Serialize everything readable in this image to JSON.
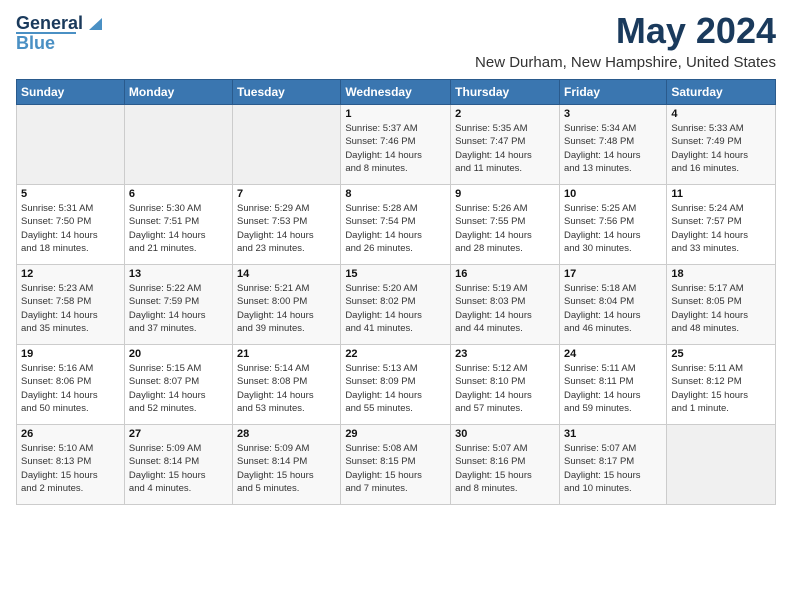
{
  "logo": {
    "line1": "General",
    "line2": "Blue"
  },
  "title": "May 2024",
  "subtitle": "New Durham, New Hampshire, United States",
  "days_of_week": [
    "Sunday",
    "Monday",
    "Tuesday",
    "Wednesday",
    "Thursday",
    "Friday",
    "Saturday"
  ],
  "weeks": [
    [
      {
        "day": "",
        "detail": ""
      },
      {
        "day": "",
        "detail": ""
      },
      {
        "day": "",
        "detail": ""
      },
      {
        "day": "1",
        "detail": "Sunrise: 5:37 AM\nSunset: 7:46 PM\nDaylight: 14 hours\nand 8 minutes."
      },
      {
        "day": "2",
        "detail": "Sunrise: 5:35 AM\nSunset: 7:47 PM\nDaylight: 14 hours\nand 11 minutes."
      },
      {
        "day": "3",
        "detail": "Sunrise: 5:34 AM\nSunset: 7:48 PM\nDaylight: 14 hours\nand 13 minutes."
      },
      {
        "day": "4",
        "detail": "Sunrise: 5:33 AM\nSunset: 7:49 PM\nDaylight: 14 hours\nand 16 minutes."
      }
    ],
    [
      {
        "day": "5",
        "detail": "Sunrise: 5:31 AM\nSunset: 7:50 PM\nDaylight: 14 hours\nand 18 minutes."
      },
      {
        "day": "6",
        "detail": "Sunrise: 5:30 AM\nSunset: 7:51 PM\nDaylight: 14 hours\nand 21 minutes."
      },
      {
        "day": "7",
        "detail": "Sunrise: 5:29 AM\nSunset: 7:53 PM\nDaylight: 14 hours\nand 23 minutes."
      },
      {
        "day": "8",
        "detail": "Sunrise: 5:28 AM\nSunset: 7:54 PM\nDaylight: 14 hours\nand 26 minutes."
      },
      {
        "day": "9",
        "detail": "Sunrise: 5:26 AM\nSunset: 7:55 PM\nDaylight: 14 hours\nand 28 minutes."
      },
      {
        "day": "10",
        "detail": "Sunrise: 5:25 AM\nSunset: 7:56 PM\nDaylight: 14 hours\nand 30 minutes."
      },
      {
        "day": "11",
        "detail": "Sunrise: 5:24 AM\nSunset: 7:57 PM\nDaylight: 14 hours\nand 33 minutes."
      }
    ],
    [
      {
        "day": "12",
        "detail": "Sunrise: 5:23 AM\nSunset: 7:58 PM\nDaylight: 14 hours\nand 35 minutes."
      },
      {
        "day": "13",
        "detail": "Sunrise: 5:22 AM\nSunset: 7:59 PM\nDaylight: 14 hours\nand 37 minutes."
      },
      {
        "day": "14",
        "detail": "Sunrise: 5:21 AM\nSunset: 8:00 PM\nDaylight: 14 hours\nand 39 minutes."
      },
      {
        "day": "15",
        "detail": "Sunrise: 5:20 AM\nSunset: 8:02 PM\nDaylight: 14 hours\nand 41 minutes."
      },
      {
        "day": "16",
        "detail": "Sunrise: 5:19 AM\nSunset: 8:03 PM\nDaylight: 14 hours\nand 44 minutes."
      },
      {
        "day": "17",
        "detail": "Sunrise: 5:18 AM\nSunset: 8:04 PM\nDaylight: 14 hours\nand 46 minutes."
      },
      {
        "day": "18",
        "detail": "Sunrise: 5:17 AM\nSunset: 8:05 PM\nDaylight: 14 hours\nand 48 minutes."
      }
    ],
    [
      {
        "day": "19",
        "detail": "Sunrise: 5:16 AM\nSunset: 8:06 PM\nDaylight: 14 hours\nand 50 minutes."
      },
      {
        "day": "20",
        "detail": "Sunrise: 5:15 AM\nSunset: 8:07 PM\nDaylight: 14 hours\nand 52 minutes."
      },
      {
        "day": "21",
        "detail": "Sunrise: 5:14 AM\nSunset: 8:08 PM\nDaylight: 14 hours\nand 53 minutes."
      },
      {
        "day": "22",
        "detail": "Sunrise: 5:13 AM\nSunset: 8:09 PM\nDaylight: 14 hours\nand 55 minutes."
      },
      {
        "day": "23",
        "detail": "Sunrise: 5:12 AM\nSunset: 8:10 PM\nDaylight: 14 hours\nand 57 minutes."
      },
      {
        "day": "24",
        "detail": "Sunrise: 5:11 AM\nSunset: 8:11 PM\nDaylight: 14 hours\nand 59 minutes."
      },
      {
        "day": "25",
        "detail": "Sunrise: 5:11 AM\nSunset: 8:12 PM\nDaylight: 15 hours\nand 1 minute."
      }
    ],
    [
      {
        "day": "26",
        "detail": "Sunrise: 5:10 AM\nSunset: 8:13 PM\nDaylight: 15 hours\nand 2 minutes."
      },
      {
        "day": "27",
        "detail": "Sunrise: 5:09 AM\nSunset: 8:14 PM\nDaylight: 15 hours\nand 4 minutes."
      },
      {
        "day": "28",
        "detail": "Sunrise: 5:09 AM\nSunset: 8:14 PM\nDaylight: 15 hours\nand 5 minutes."
      },
      {
        "day": "29",
        "detail": "Sunrise: 5:08 AM\nSunset: 8:15 PM\nDaylight: 15 hours\nand 7 minutes."
      },
      {
        "day": "30",
        "detail": "Sunrise: 5:07 AM\nSunset: 8:16 PM\nDaylight: 15 hours\nand 8 minutes."
      },
      {
        "day": "31",
        "detail": "Sunrise: 5:07 AM\nSunset: 8:17 PM\nDaylight: 15 hours\nand 10 minutes."
      },
      {
        "day": "",
        "detail": ""
      }
    ]
  ]
}
